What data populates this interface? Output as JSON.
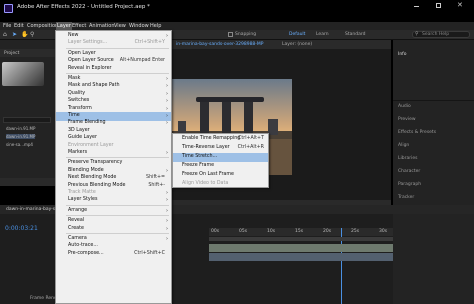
{
  "window": {
    "title": "Adobe After Effects 2022 - Untitled Project.aep *"
  },
  "menubar": [
    "File",
    "Edit",
    "Composition",
    "Layer",
    "Effect",
    "Animation",
    "View",
    "Window",
    "Help"
  ],
  "workspace": {
    "default": "Default",
    "learn": "Learn",
    "standard": "Standard",
    "search": "Search Help",
    "snapping": "Snapping"
  },
  "project": {
    "title": "Project",
    "items": [
      "dawn-in.91.MP",
      "dawn-in.91.MP",
      "sine-sa...mp4"
    ]
  },
  "composition": {
    "tab": "in-marina-bay-sands-over-3298988-MP",
    "layer_tab": "Layer: (none)"
  },
  "right_panel": [
    "Info",
    "Audio",
    "Preview",
    "Effects & Presets",
    "Align",
    "Libraries",
    "Character",
    "Paragraph",
    "Tracker"
  ],
  "timeline": {
    "comp_name": "dawn-in-marina-bay-sa",
    "timecode": "0:00:03:21",
    "ruler": [
      "00s",
      "05s",
      "10s",
      "15s",
      "20s",
      "25s",
      "30s"
    ],
    "footer": "Frame Rende"
  },
  "layer_menu": [
    {
      "label": "New",
      "arrow": true
    },
    {
      "label": "Layer Settings...",
      "shortcut": "Ctrl+Shift+Y",
      "disabled": true
    },
    {
      "sep": true
    },
    {
      "label": "Open Layer"
    },
    {
      "label": "Open Layer Source",
      "shortcut": "Alt+Numpad Enter"
    },
    {
      "label": "Reveal in Explorer"
    },
    {
      "sep": true
    },
    {
      "label": "Mask",
      "arrow": true
    },
    {
      "label": "Mask and Shape Path",
      "arrow": true
    },
    {
      "label": "Quality",
      "arrow": true
    },
    {
      "label": "Switches",
      "arrow": true
    },
    {
      "label": "Transform",
      "arrow": true
    },
    {
      "label": "Time",
      "arrow": true,
      "highlight": true
    },
    {
      "label": "Frame Blending",
      "arrow": true
    },
    {
      "label": "3D Layer"
    },
    {
      "label": "Guide Layer"
    },
    {
      "label": "Environment Layer",
      "disabled": true
    },
    {
      "label": "Markers",
      "arrow": true
    },
    {
      "sep": true
    },
    {
      "label": "Preserve Transparency"
    },
    {
      "label": "Blending Mode",
      "arrow": true
    },
    {
      "label": "Next Blending Mode",
      "shortcut": "Shift+="
    },
    {
      "label": "Previous Blending Mode",
      "shortcut": "Shift+-"
    },
    {
      "label": "Track Matte",
      "disabled": true,
      "arrow": true
    },
    {
      "label": "Layer Styles",
      "arrow": true
    },
    {
      "sep": true
    },
    {
      "label": "Arrange",
      "arrow": true
    },
    {
      "sep": true
    },
    {
      "label": "Reveal",
      "arrow": true
    },
    {
      "label": "Create",
      "arrow": true
    },
    {
      "sep": true
    },
    {
      "label": "Camera",
      "arrow": true
    },
    {
      "label": "Auto-trace..."
    },
    {
      "label": "Pre-compose...",
      "shortcut": "Ctrl+Shift+C"
    }
  ],
  "time_submenu": [
    {
      "label": "Enable Time Remapping",
      "shortcut": "Ctrl+Alt+T"
    },
    {
      "label": "Time-Reverse Layer",
      "shortcut": "Ctrl+Alt+R"
    },
    {
      "label": "Time Stretch...",
      "highlight": true
    },
    {
      "label": "Freeze Frame"
    },
    {
      "label": "Freeze On Last Frame"
    },
    {
      "label": "Align Video to Data",
      "disabled": true
    }
  ],
  "colors": {
    "menu_bg": "#f0f0f0",
    "highlight": "#9ec0e6",
    "accent": "#4a90e2",
    "app_bg": "#232323"
  }
}
